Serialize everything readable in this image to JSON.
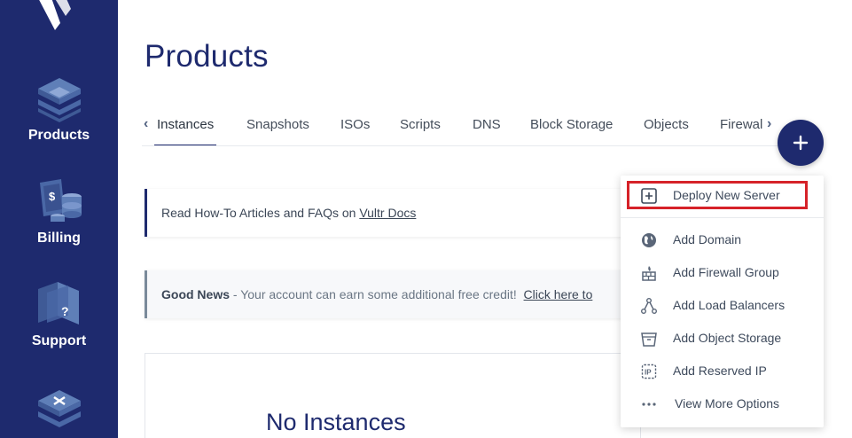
{
  "colors": {
    "sidebar": "#1e2a6e",
    "accent": "#1e2a6e",
    "highlight_border": "#d62229",
    "menu_text": "#3e4a5c"
  },
  "sidebar": {
    "logo_icon": "vultr-logo",
    "items": [
      {
        "label": "Products",
        "icon": "stacked-layers-icon"
      },
      {
        "label": "Billing",
        "icon": "billing-coins-icon"
      },
      {
        "label": "Support",
        "icon": "support-question-icon"
      },
      {
        "label": "",
        "icon": "stacked-layers-x-icon"
      }
    ]
  },
  "page": {
    "title": "Products"
  },
  "tabs": {
    "items": [
      "Instances",
      "Snapshots",
      "ISOs",
      "Scripts",
      "DNS",
      "Block Storage",
      "Objects",
      "Firewal"
    ],
    "active": "Instances",
    "prev_icon": "chevron-left-icon",
    "next_icon": "chevron-right-icon"
  },
  "notices": {
    "docs": {
      "prefix": "Read How-To Articles and FAQs on ",
      "link": "Vultr Docs"
    },
    "credit": {
      "strong": "Good News",
      "text": " - Your account can earn some additional free credit!  ",
      "link": "Click here to"
    }
  },
  "empty_state": {
    "title": "No Instances"
  },
  "fab": {
    "icon": "plus-icon"
  },
  "menu": {
    "deploy": {
      "label": "Deploy New Server",
      "icon": "plus-square-icon"
    },
    "items": [
      {
        "label": "Add Domain",
        "icon": "globe-icon"
      },
      {
        "label": "Add Firewall Group",
        "icon": "firewall-icon"
      },
      {
        "label": "Add Load Balancers",
        "icon": "load-balancer-icon"
      },
      {
        "label": "Add Object Storage",
        "icon": "object-storage-icon"
      },
      {
        "label": "Add Reserved IP",
        "icon": "reserved-ip-icon"
      },
      {
        "label": "View More Options",
        "icon": "more-dots-icon"
      }
    ]
  }
}
